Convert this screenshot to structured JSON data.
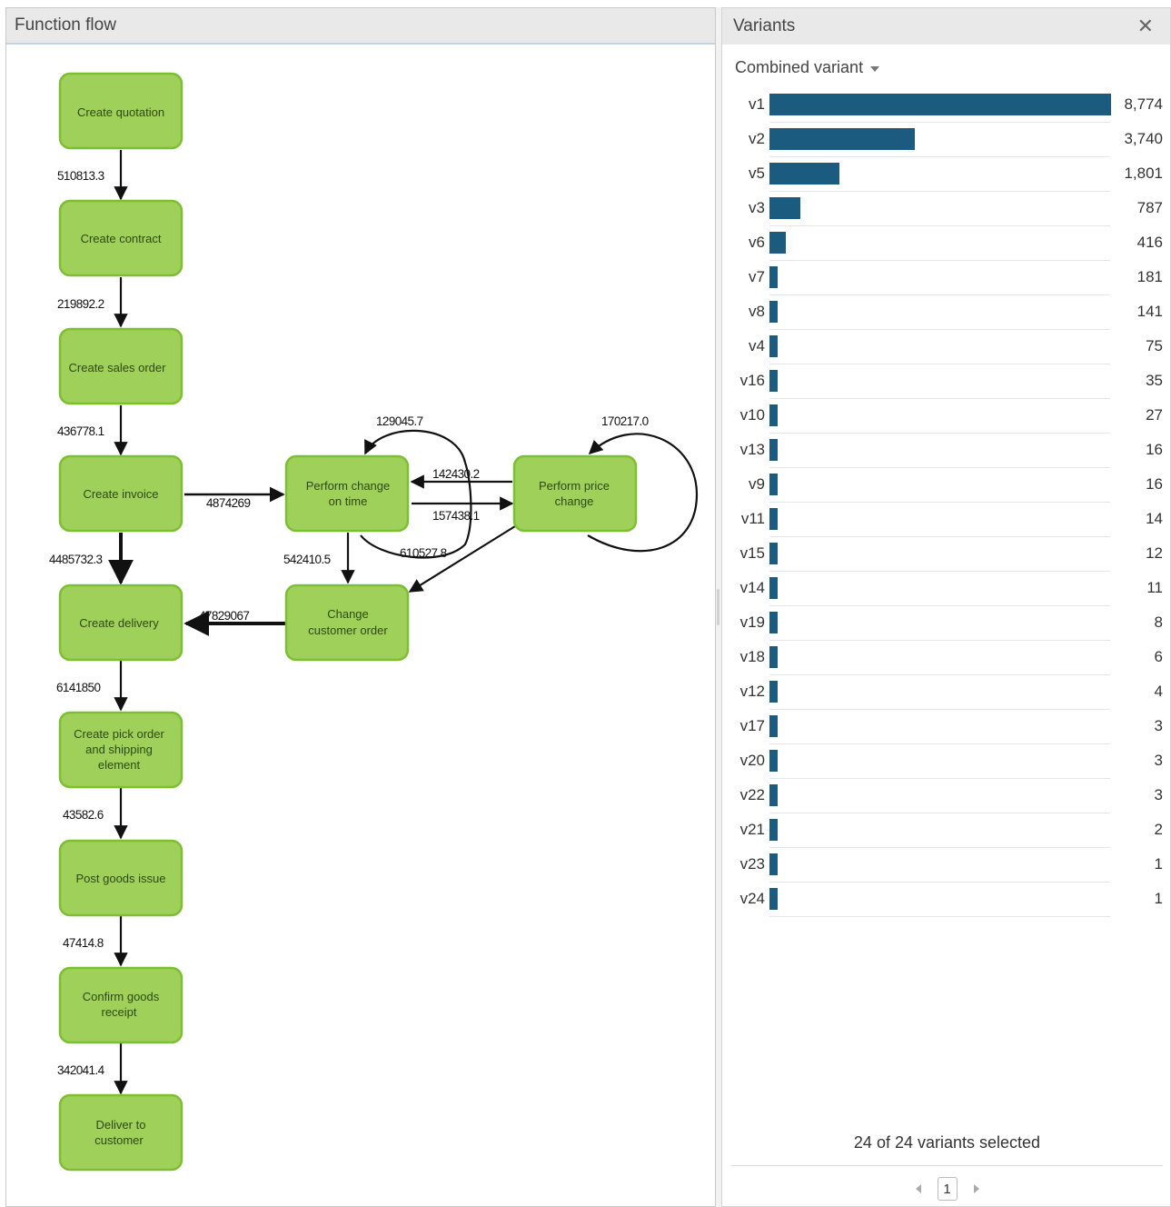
{
  "left_panel": {
    "title": "Function flow",
    "nodes": {
      "create_quotation": [
        "Create quotation"
      ],
      "create_contract": [
        "Create contract"
      ],
      "create_sales_order": [
        "Create sales order"
      ],
      "create_invoice": [
        "Create invoice"
      ],
      "perform_change_on_time": [
        "Perform change",
        "on time"
      ],
      "perform_price_change": [
        "Perform price",
        "change"
      ],
      "create_delivery": [
        "Create delivery"
      ],
      "change_customer_order": [
        "Change",
        "customer order"
      ],
      "create_pick_order": [
        "Create pick order",
        "and shipping",
        "element"
      ],
      "post_goods_issue": [
        "Post goods issue"
      ],
      "confirm_goods_receipt": [
        "Confirm goods",
        "receipt"
      ],
      "deliver_to_customer": [
        "Deliver to",
        "customer"
      ]
    },
    "edge_labels": {
      "quotation_to_contract": "510813.3",
      "contract_to_sales_order": "219892.2",
      "sales_order_to_invoice": "436778.1",
      "invoice_to_perform_change": "4874269",
      "invoice_to_delivery": "4485732.3",
      "perform_change_self": "129045.7",
      "price_change_self": "170217.0",
      "price_to_perform_change": "142430.2",
      "perform_to_price_change": "157438.1",
      "perform_change_loop": "610527.8",
      "perform_change_to_change_order": "542410.5",
      "change_order_to_delivery": "47829067",
      "delivery_to_pick_order": "6141850",
      "pick_order_to_post_goods": "43582.6",
      "post_goods_to_confirm": "47414.8",
      "confirm_to_deliver": "342041.4"
    }
  },
  "right_panel": {
    "title": "Variants",
    "close_icon": "close-icon",
    "selector_label": "Combined variant",
    "accent_color": "#1a5b7f",
    "variants": [
      {
        "label": "v1",
        "value": 8774,
        "display": "8,774"
      },
      {
        "label": "v2",
        "value": 3740,
        "display": "3,740"
      },
      {
        "label": "v5",
        "value": 1801,
        "display": "1,801"
      },
      {
        "label": "v3",
        "value": 787,
        "display": "787"
      },
      {
        "label": "v6",
        "value": 416,
        "display": "416"
      },
      {
        "label": "v7",
        "value": 181,
        "display": "181"
      },
      {
        "label": "v8",
        "value": 141,
        "display": "141"
      },
      {
        "label": "v4",
        "value": 75,
        "display": "75"
      },
      {
        "label": "v16",
        "value": 35,
        "display": "35"
      },
      {
        "label": "v10",
        "value": 27,
        "display": "27"
      },
      {
        "label": "v13",
        "value": 16,
        "display": "16"
      },
      {
        "label": "v9",
        "value": 16,
        "display": "16"
      },
      {
        "label": "v11",
        "value": 14,
        "display": "14"
      },
      {
        "label": "v15",
        "value": 12,
        "display": "12"
      },
      {
        "label": "v14",
        "value": 11,
        "display": "11"
      },
      {
        "label": "v19",
        "value": 8,
        "display": "8"
      },
      {
        "label": "v18",
        "value": 6,
        "display": "6"
      },
      {
        "label": "v12",
        "value": 4,
        "display": "4"
      },
      {
        "label": "v17",
        "value": 3,
        "display": "3"
      },
      {
        "label": "v20",
        "value": 3,
        "display": "3"
      },
      {
        "label": "v22",
        "value": 3,
        "display": "3"
      },
      {
        "label": "v21",
        "value": 2,
        "display": "2"
      },
      {
        "label": "v23",
        "value": 1,
        "display": "1"
      },
      {
        "label": "v24",
        "value": 1,
        "display": "1"
      }
    ],
    "selected_text": "24 of 24 variants selected",
    "pager": {
      "current_page": "1"
    }
  }
}
